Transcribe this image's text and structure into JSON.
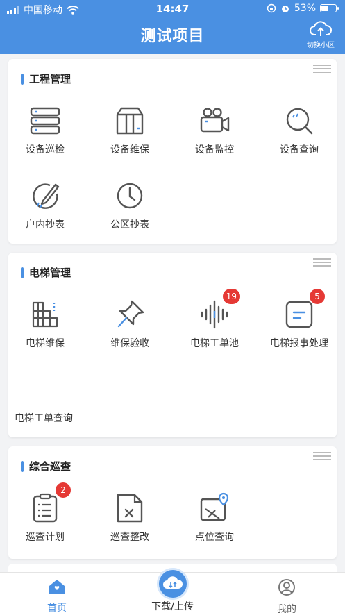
{
  "status_bar": {
    "carrier": "中国移动",
    "time": "14:47",
    "battery": "53%",
    "battery_level": 0.53
  },
  "header": {
    "title": "测试项目",
    "switch_label": "切换小区",
    "bg_color": "#4a90e2"
  },
  "sections": {
    "engineering": {
      "title": "工程管理",
      "items": [
        {
          "label": "设备巡检",
          "icon": "server-icon"
        },
        {
          "label": "设备维保",
          "icon": "box-icon"
        },
        {
          "label": "设备监控",
          "icon": "video-camera-icon"
        },
        {
          "label": "设备查询",
          "icon": "magnifier-icon"
        },
        {
          "label": "户内抄表",
          "icon": "pencil-circle-icon"
        },
        {
          "label": "公区抄表",
          "icon": "clock-icon"
        }
      ]
    },
    "elevator": {
      "title": "电梯管理",
      "items": [
        {
          "label": "电梯维保",
          "icon": "grid-building-icon"
        },
        {
          "label": "维保验收",
          "icon": "pushpin-icon"
        },
        {
          "label": "电梯工单池",
          "icon": "sound-wave-icon",
          "badge": "19"
        },
        {
          "label": "电梯报事处理",
          "icon": "note-icon",
          "badge": "5"
        }
      ],
      "extra_link": "电梯工单查询"
    },
    "inspection": {
      "title": "综合巡查",
      "items": [
        {
          "label": "巡查计划",
          "icon": "clipboard-icon",
          "badge": "2"
        },
        {
          "label": "巡查整改",
          "icon": "document-x-icon"
        },
        {
          "label": "点位查询",
          "icon": "map-pin-icon"
        }
      ]
    }
  },
  "tabbar": {
    "home": "首页",
    "upload": "下载/上传",
    "mine": "我的"
  }
}
